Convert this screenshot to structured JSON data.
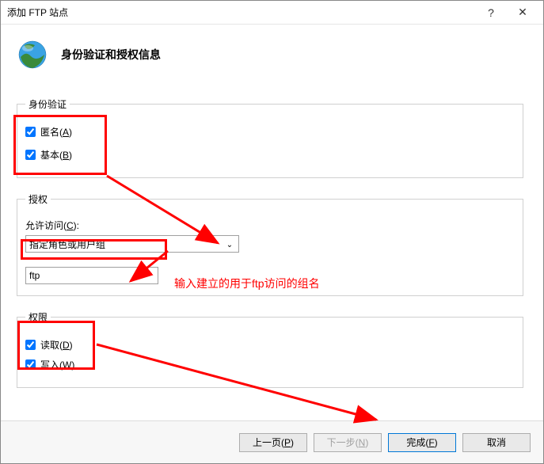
{
  "titlebar": {
    "text": "添加 FTP 站点"
  },
  "header": {
    "title": "身份验证和授权信息"
  },
  "auth_group": {
    "legend": "身份验证",
    "anonymous": {
      "label_pre": "匿名(",
      "label_u": "A",
      "label_post": ")"
    },
    "basic": {
      "label_pre": "基本(",
      "label_u": "B",
      "label_post": ")"
    }
  },
  "authz_group": {
    "legend": "授权",
    "allow_label_pre": "允许访问(",
    "allow_label_u": "C",
    "allow_label_post": "):",
    "select_value": "指定角色或用户组",
    "input_value": "ftp"
  },
  "perm_group": {
    "legend": "权限",
    "read": {
      "label_pre": "读取(",
      "label_u": "D",
      "label_post": ")"
    },
    "write": {
      "label_pre": "写入(",
      "label_u": "W",
      "label_post": ")"
    }
  },
  "annotation": {
    "text": "输入建立的用于ftp访问的组名"
  },
  "footer": {
    "prev_pre": "上一页(",
    "prev_u": "P",
    "prev_post": ")",
    "next_pre": "下一步(",
    "next_u": "N",
    "next_post": ")",
    "finish_pre": "完成(",
    "finish_u": "F",
    "finish_post": ")",
    "cancel": "取消"
  }
}
